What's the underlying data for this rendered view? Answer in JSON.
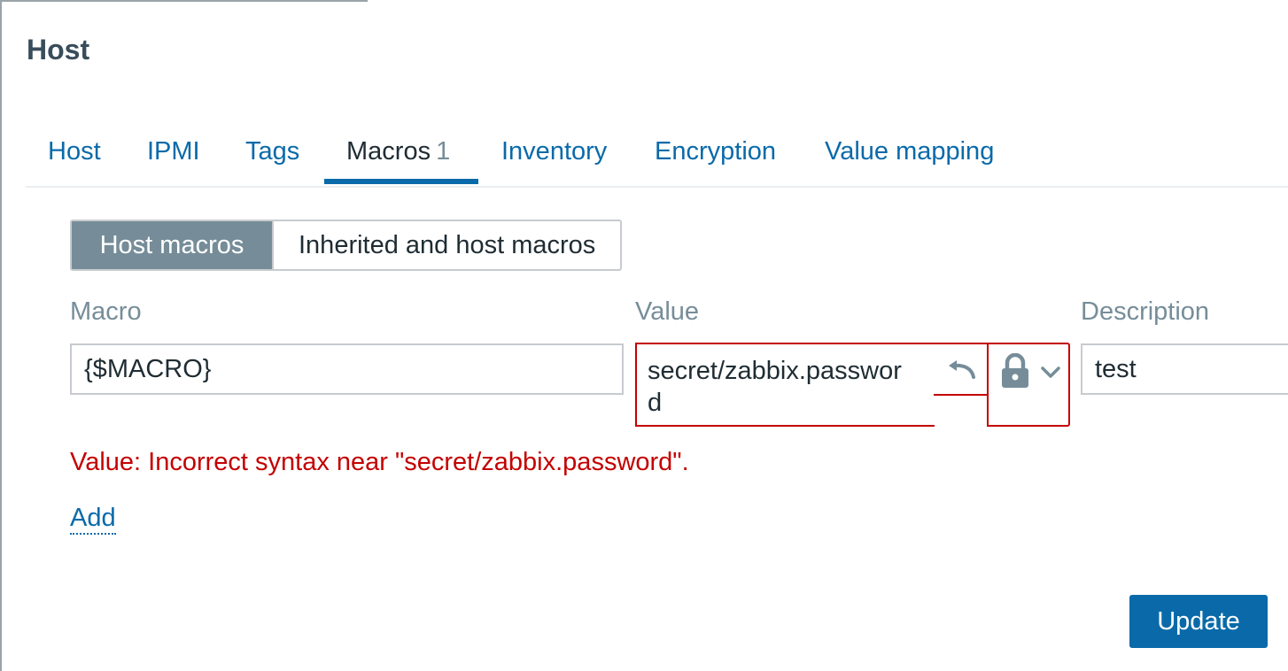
{
  "dialog": {
    "title": "Host"
  },
  "tabs": [
    {
      "label": "Host"
    },
    {
      "label": "IPMI"
    },
    {
      "label": "Tags"
    },
    {
      "label": "Macros",
      "count": "1",
      "active": true
    },
    {
      "label": "Inventory"
    },
    {
      "label": "Encryption"
    },
    {
      "label": "Value mapping"
    }
  ],
  "macro_mode": {
    "options": [
      "Host macros",
      "Inherited and host macros"
    ],
    "selected": "Host macros"
  },
  "columns": {
    "macro": "Macro",
    "value": "Value",
    "description": "Description"
  },
  "row": {
    "macro": "{$MACRO}",
    "value": "secret/zabbix.password",
    "description": "test",
    "value_type_icon": "lock-icon"
  },
  "error": "Value: Incorrect syntax near \"secret/zabbix.password\".",
  "actions": {
    "add": "Add",
    "update": "Update"
  },
  "colors": {
    "link": "#0a6aa9",
    "error": "#c40000",
    "active_segment": "#768d99",
    "primary_button": "#0a6aa9"
  }
}
